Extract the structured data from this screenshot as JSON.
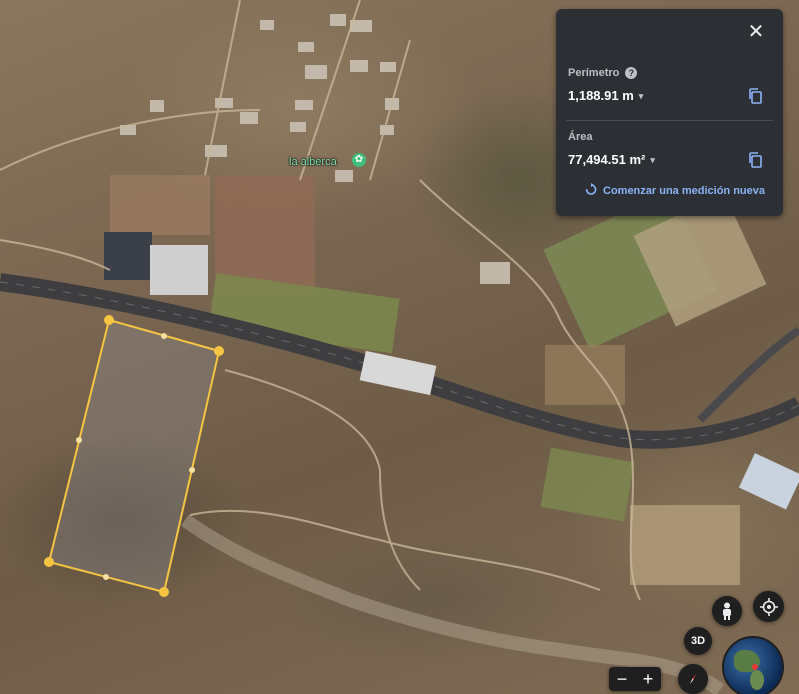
{
  "panel": {
    "perimeter_label": "Perímetro",
    "perimeter_value": "1,188.91 m",
    "area_label": "Área",
    "area_value": "77,494.51 m²",
    "new_measurement": "Comenzar una medición nueva",
    "close_glyph": "✕",
    "help_glyph": "?",
    "caret_glyph": "▾"
  },
  "map": {
    "place_label": "la alberca",
    "place_icon": "park-icon",
    "measure_color": "#f5c542",
    "road_color": "#3e3e40"
  },
  "controls": {
    "view_3d": "3D",
    "zoom_out": "−",
    "zoom_in": "+",
    "icons": [
      "pegman-icon",
      "my-location-icon",
      "compass-icon",
      "globe-icon"
    ]
  }
}
